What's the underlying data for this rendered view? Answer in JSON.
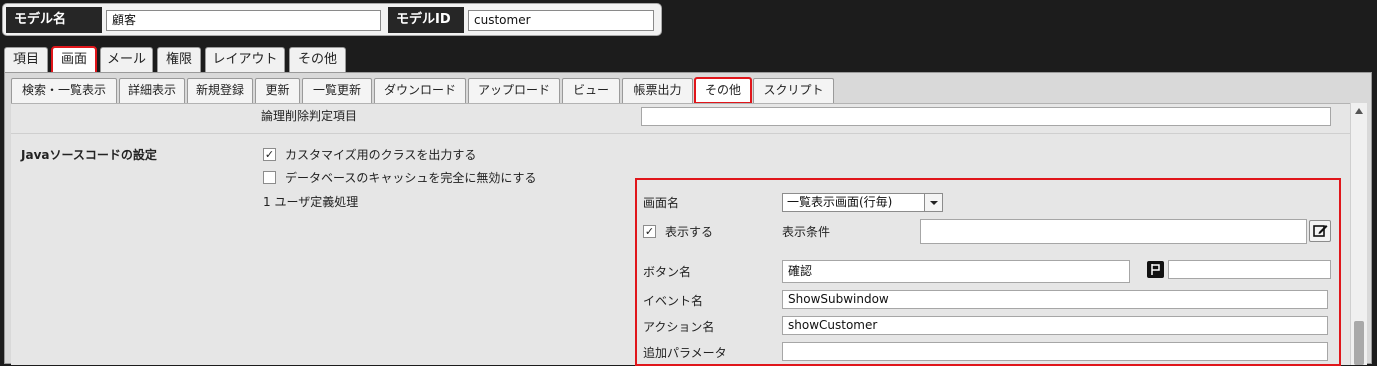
{
  "model_header": {
    "model_name_label": "モデル名",
    "model_name_value": "顧客",
    "model_id_label": "モデルID",
    "model_id_value": "customer"
  },
  "main_tabs": [
    {
      "label": "項目",
      "active": false
    },
    {
      "label": "画面",
      "active": true
    },
    {
      "label": "メール",
      "active": false
    },
    {
      "label": "権限",
      "active": false
    },
    {
      "label": "レイアウト",
      "active": false
    },
    {
      "label": "その他",
      "active": false
    }
  ],
  "sub_tabs": [
    {
      "label": "検索・一覧表示",
      "active": false
    },
    {
      "label": "詳細表示",
      "active": false
    },
    {
      "label": "新規登録",
      "active": false
    },
    {
      "label": "更新",
      "active": false
    },
    {
      "label": "一覧更新",
      "active": false
    },
    {
      "label": "ダウンロード",
      "active": false
    },
    {
      "label": "アップロード",
      "active": false
    },
    {
      "label": "ビュー",
      "active": false
    },
    {
      "label": "帳票出力",
      "active": false
    },
    {
      "label": "その他",
      "active": true
    },
    {
      "label": "スクリプト",
      "active": false
    }
  ],
  "content": {
    "logical_delete_label": "論理削除判定項目",
    "logical_delete_value": "",
    "java_section_label": "Javaソースコードの設定",
    "customize_class_checked": true,
    "customize_class_label": "カスタマイズ用のクラスを出力する",
    "disable_cache_checked": false,
    "disable_cache_label": "データベースのキャッシュを完全に無効にする",
    "user_process_label": "1 ユーザ定義処理",
    "detail": {
      "screen_name_label": "画面名",
      "screen_name_value": "一覧表示画面(行毎)",
      "display_checked": true,
      "display_label": "表示する",
      "display_condition_label": "表示条件",
      "display_condition_value": "",
      "button_name_label": "ボタン名",
      "button_name_value": "確認",
      "button_name_extra_value": "",
      "event_name_label": "イベント名",
      "event_name_value": "ShowSubwindow",
      "action_name_label": "アクション名",
      "action_name_value": "showCustomer",
      "extra_param_label": "追加パラメータ",
      "extra_param_value": ""
    }
  },
  "icons": {
    "edit": "edit-icon",
    "flag": "flag-icon",
    "checkmark": "✓"
  },
  "colors": {
    "highlight": "#e0161b",
    "header_label_bg": "#262626",
    "page_bg": "#1c1c1c"
  }
}
